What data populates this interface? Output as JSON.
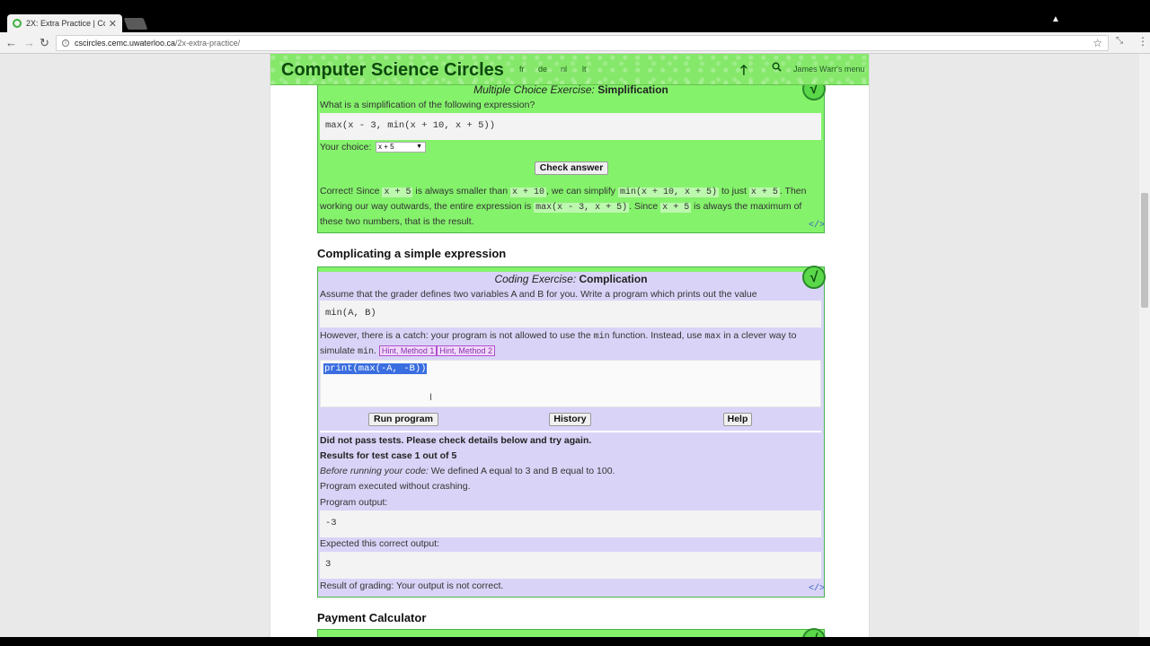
{
  "browser": {
    "tab_title": "2X: Extra Practice | Comp",
    "url_host": "cscircles.cemc.uwaterloo.ca",
    "url_path": "/2x-extra-practice/"
  },
  "site": {
    "title": "Computer Science Circles",
    "langs": [
      "fr",
      "de",
      "nl",
      "lt"
    ],
    "user_menu": "James Warr's menu"
  },
  "mc": {
    "title_kind": "Multiple Choice Exercise:",
    "title_name": "Simplification",
    "question": "What is a simplification of the following expression?",
    "expression": "max(x - 3, min(x + 10, x + 5))",
    "choice_label": "Your choice:",
    "choice_value": "x + 5",
    "check_button": "Check answer",
    "fb": {
      "a": "Correct! Since",
      "c1": "x + 5",
      "b": "is always smaller than",
      "c2": "x + 10",
      "c": ", we can simplify",
      "c3": "min(x + 10, x + 5)",
      "d": "to just",
      "c4": "x + 5",
      "e": ". Then",
      "f": "working our way outwards, the entire expression is",
      "c5": "max(x - 3, x + 5)",
      "g": ". Since",
      "c6": "x + 5",
      "h": "is always the maximum of",
      "i": "these two numbers, that is the result."
    }
  },
  "section1": {
    "heading": "Complicating a simple expression"
  },
  "coding": {
    "title_kind": "Coding Exercise:",
    "title_name": "Complication",
    "intro": "Assume that the grader defines two variables A and B for you. Write a program which prints out the value",
    "expression": "min(A, B)",
    "catch_a": "However, there is a catch: your program is not allowed to use the",
    "catch_min": "min",
    "catch_b": "function. Instead, use",
    "catch_max": "max",
    "catch_c": "in a clever way to",
    "simulate": "simulate",
    "simulate_min": "min",
    "hint1": "Hint, Method 1",
    "hint2": "Hint, Method 2",
    "code": "print(max(-A, -B))",
    "run_button": "Run program",
    "history_button": "History",
    "help_button": "Help",
    "result_fail": "Did not pass tests. Please check details below and try again.",
    "result_case": "Results for test case 1 out of 5",
    "before_label": "Before running your code:",
    "before_text": "We defined A equal to 3 and B equal to 100.",
    "executed": "Program executed without crashing.",
    "output_label": "Program output:",
    "output_value": "-3",
    "expected_label": "Expected this correct output:",
    "expected_value": "3",
    "grading": "Result of grading: Your output is not correct."
  },
  "section2": {
    "heading": "Payment Calculator"
  },
  "colors": {
    "green_box": "#85f26c",
    "purple_box": "#d9d4f7",
    "header": "#86e86b"
  }
}
